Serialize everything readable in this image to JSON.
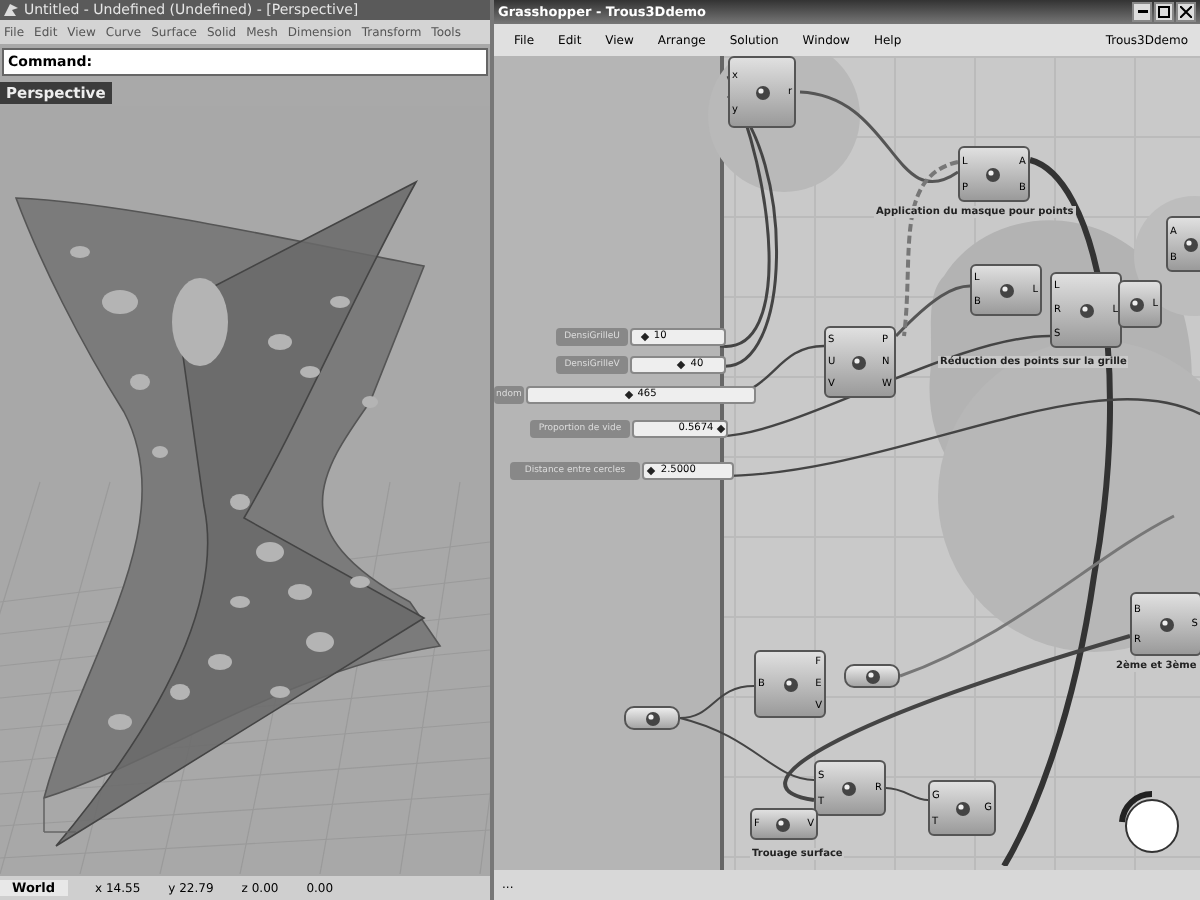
{
  "rhino": {
    "title": "Untitled - Undefined (Undefined) - [Perspective]",
    "menu": [
      "File",
      "Edit",
      "View",
      "Curve",
      "Surface",
      "Solid",
      "Mesh",
      "Dimension",
      "Transform",
      "Tools"
    ],
    "command_label": "Command:",
    "viewport_label": "Perspective",
    "status": {
      "cplane": "World",
      "x": "x 14.55",
      "y": "y 22.79",
      "z": "z 0.00",
      "extra": "0.00"
    }
  },
  "grasshopper": {
    "title": "Grasshopper - Trous3Ddemo",
    "menu": [
      "File",
      "Edit",
      "View",
      "Arrange",
      "Solution",
      "Window",
      "Help"
    ],
    "document": "Trous3Ddemo",
    "sliders": [
      {
        "label": "DensiGrilleU",
        "value": "10",
        "level": 0.15
      },
      {
        "label": "DensiGrilleV",
        "value": "40",
        "level": 0.55
      },
      {
        "label": "ndom",
        "value": "465",
        "level": 0.45
      },
      {
        "label": "Proportion de vide",
        "value": "0.5674",
        "level": 0.95
      },
      {
        "label": "Distance entre cercles",
        "value": "2.5000",
        "level": 0.1
      }
    ],
    "groups": [
      {
        "label": "Application du masque pour points"
      },
      {
        "label": "Réduction des points sur la grille"
      },
      {
        "label": "2ème et 3ème"
      },
      {
        "label": "Trouage surface"
      }
    ],
    "nodes": [
      {
        "kind": "component",
        "inputs": [
          "x",
          "y"
        ],
        "outputs": [
          "r"
        ]
      },
      {
        "kind": "component",
        "inputs": [
          "L",
          "P"
        ],
        "outputs": [
          "A",
          "B"
        ]
      },
      {
        "kind": "component",
        "inputs": [
          "L",
          "B"
        ],
        "outputs": [
          "L"
        ]
      },
      {
        "kind": "component",
        "inputs": [
          "L",
          "R",
          "S"
        ],
        "outputs": [
          "L"
        ]
      },
      {
        "kind": "component",
        "outputs": [
          "L"
        ]
      },
      {
        "kind": "component",
        "inputs": [
          "A",
          "B"
        ]
      },
      {
        "kind": "component",
        "inputs": [
          "S",
          "U",
          "V"
        ],
        "outputs": [
          "P",
          "N",
          "W"
        ]
      },
      {
        "kind": "component",
        "inputs": [
          "B"
        ],
        "outputs": [
          "F",
          "E",
          "V"
        ]
      },
      {
        "kind": "parameter"
      },
      {
        "kind": "parameter"
      },
      {
        "kind": "component",
        "inputs": [
          "S",
          "T"
        ],
        "outputs": [
          "R"
        ]
      },
      {
        "kind": "component",
        "inputs": [
          "F"
        ],
        "outputs": [
          "V"
        ]
      },
      {
        "kind": "component",
        "inputs": [
          "G",
          "T"
        ],
        "outputs": [
          "G"
        ]
      },
      {
        "kind": "component",
        "inputs": [
          "B",
          "R"
        ],
        "outputs": [
          "S"
        ]
      }
    ],
    "status": "..."
  }
}
